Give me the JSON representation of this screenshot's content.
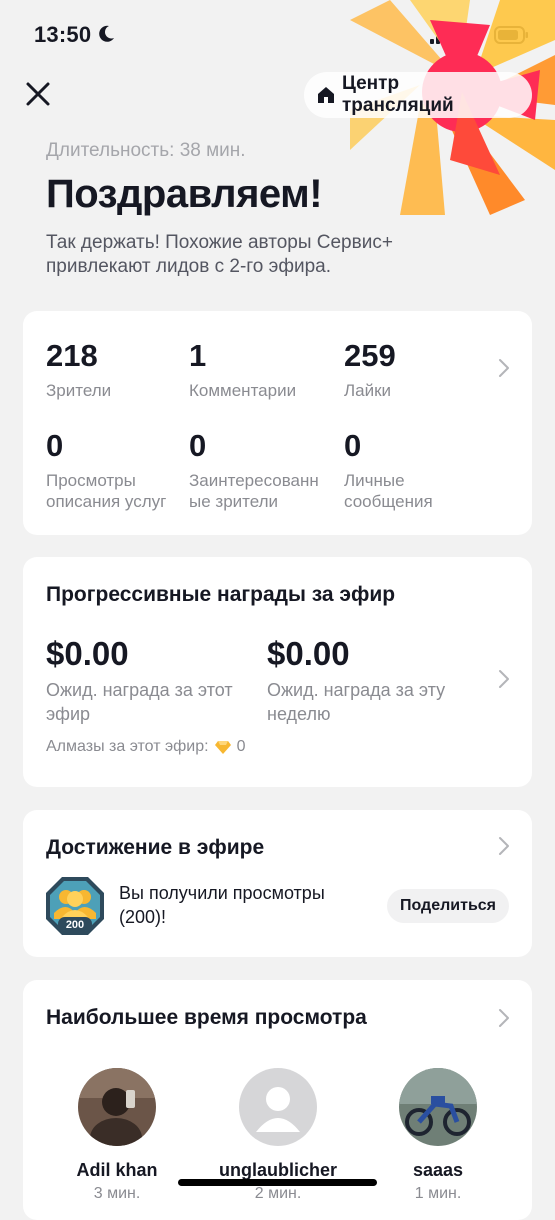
{
  "status_bar": {
    "time": "13:50"
  },
  "header": {
    "center_button_label": "Центр трансляций"
  },
  "summary": {
    "duration": "Длительность: 38 мин.",
    "title": "Поздравляем!",
    "subtitle": "Так держать! Похожие авторы Сервис+ привлекают лидов с 2-го эфира."
  },
  "stats": [
    {
      "value": "218",
      "label": "Зрители"
    },
    {
      "value": "1",
      "label": "Комментарии"
    },
    {
      "value": "259",
      "label": "Лайки"
    },
    {
      "value": "0",
      "label": "Просмотры описания услуг"
    },
    {
      "value": "0",
      "label": "Заинтересованн ые зрители"
    },
    {
      "value": "0",
      "label": "Личные сообщения"
    }
  ],
  "rewards": {
    "title": "Прогрессивные награды за эфир",
    "stream_value": "$0.00",
    "stream_label": "Ожид. награда за этот эфир",
    "week_value": "$0.00",
    "week_label": "Ожид. награда за эту неделю",
    "diamonds_label": "Алмазы за этот эфир:",
    "diamonds_value": "0"
  },
  "achievement": {
    "title": "Достижение в эфире",
    "badge_value": "200",
    "text": "Вы получили просмотры (200)!",
    "share_label": "Поделиться"
  },
  "top_viewers": {
    "title": "Наибольшее время просмотра",
    "viewers": [
      {
        "name": "Adil khan",
        "time": "3 мин."
      },
      {
        "name": "unglaublicher",
        "time": "2 мин."
      },
      {
        "name": "saaas",
        "time": "1 мин."
      }
    ]
  },
  "colors": {
    "background": "#f2f2f2",
    "card": "#ffffff",
    "text_primary": "#161823",
    "text_secondary": "#8a8b91",
    "burst_red": "#fe2c55",
    "burst_orange": "#ff8a2a",
    "burst_yellow": "#ffc43c",
    "diamond": "#f7b731",
    "battery_red": "#e0302c"
  },
  "icons": [
    "moon-icon",
    "signal-icon",
    "wifi-icon",
    "battery-icon",
    "close-icon",
    "house-icon",
    "chevron-right-icon",
    "diamond-icon",
    "achievement-badge-icon",
    "default-avatar-icon"
  ]
}
